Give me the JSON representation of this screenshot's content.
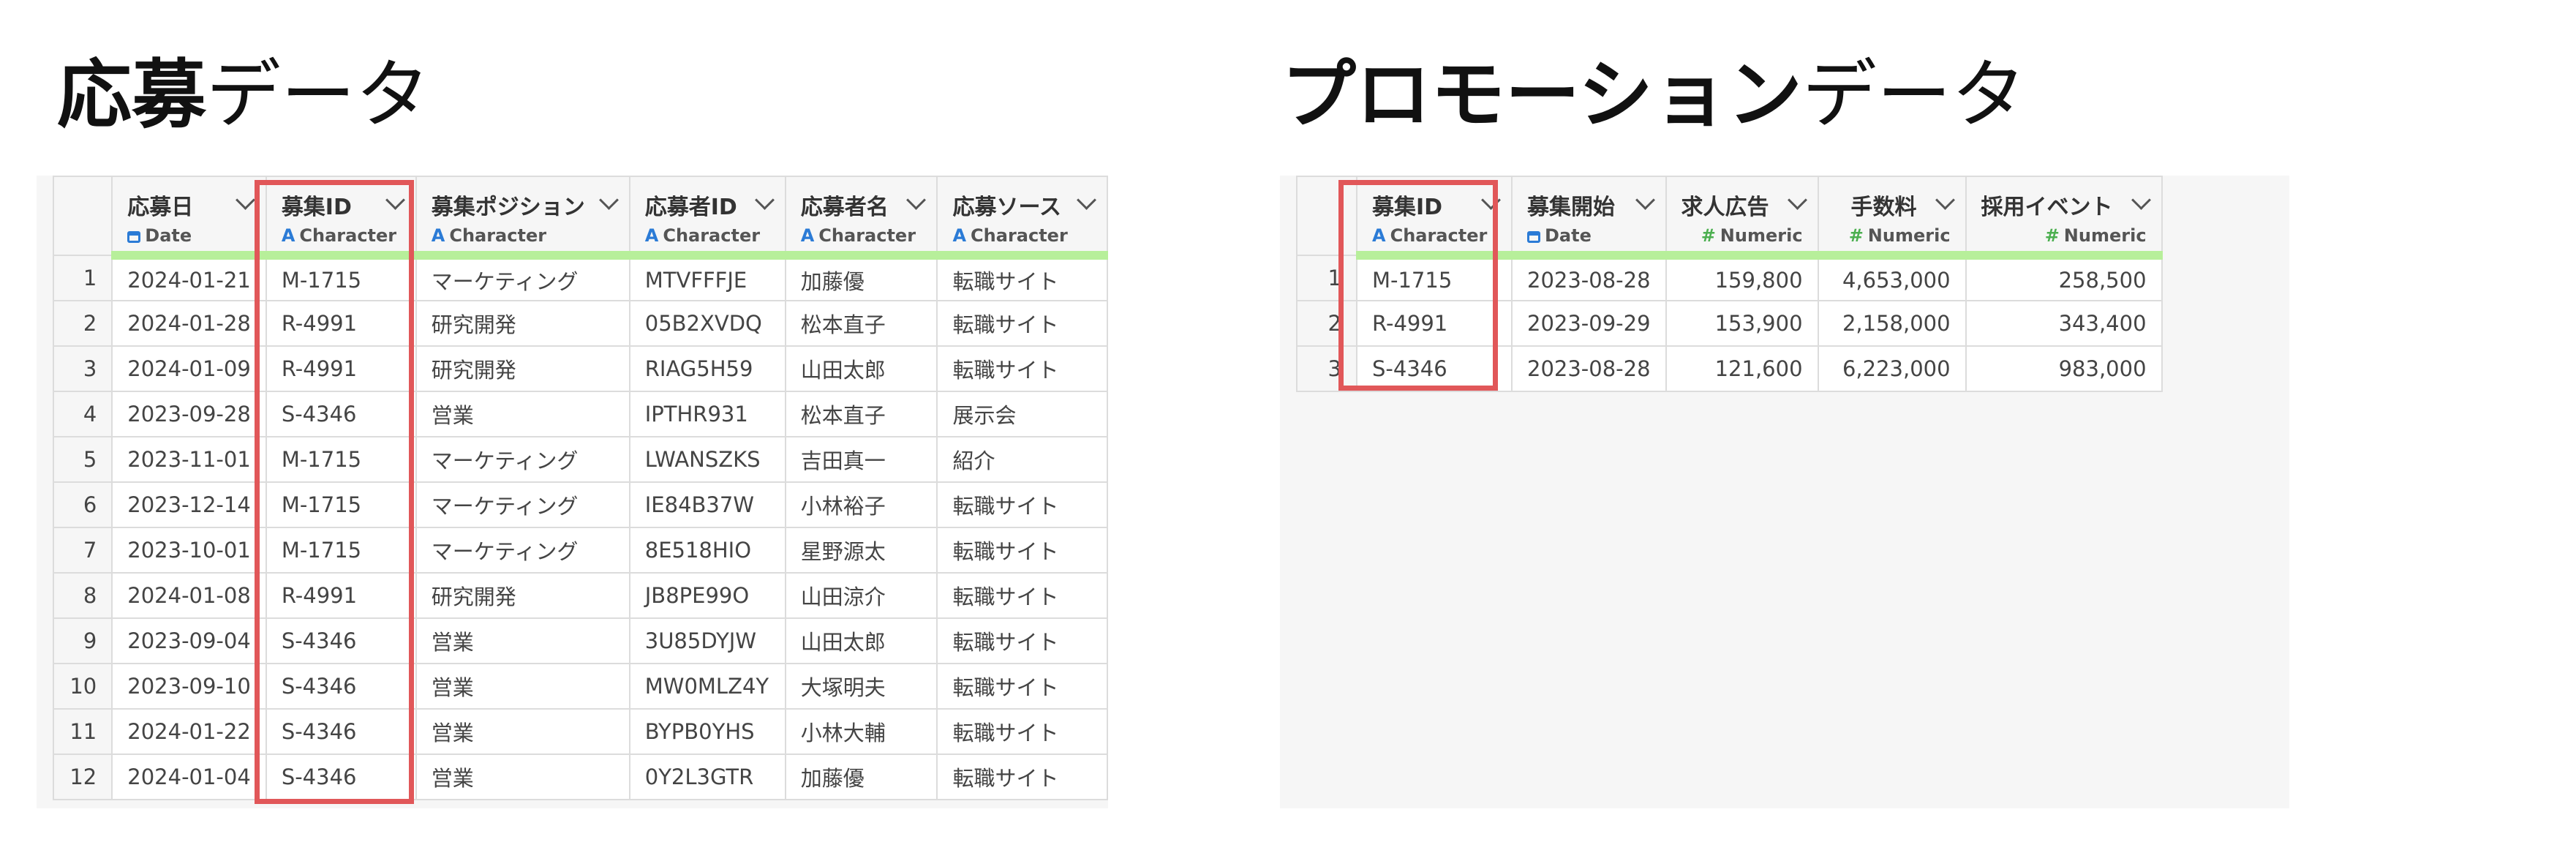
{
  "left_panel": {
    "title_bold": "応募",
    "title_light": "データ",
    "columns": [
      {
        "name": "応募日",
        "type": "Date",
        "type_icon": "calendar-icon"
      },
      {
        "name": "募集ID",
        "type": "Character",
        "type_icon": "character-type-icon"
      },
      {
        "name": "募集ポジション",
        "type": "Character",
        "type_icon": "character-type-icon"
      },
      {
        "name": "応募者ID",
        "type": "Character",
        "type_icon": "character-type-icon"
      },
      {
        "name": "応募者名",
        "type": "Character",
        "type_icon": "character-type-icon"
      },
      {
        "name": "応募ソース",
        "type": "Character",
        "type_icon": "character-type-icon"
      }
    ],
    "rows": [
      {
        "num": "1",
        "cells": [
          "2024-01-21",
          "M-1715",
          "マーケティング",
          "MTVFFFJE",
          "加藤優",
          "転職サイト"
        ]
      },
      {
        "num": "2",
        "cells": [
          "2024-01-28",
          "R-4991",
          "研究開発",
          "05B2XVDQ",
          "松本直子",
          "転職サイト"
        ]
      },
      {
        "num": "3",
        "cells": [
          "2024-01-09",
          "R-4991",
          "研究開発",
          "RIAG5H59",
          "山田太郎",
          "転職サイト"
        ]
      },
      {
        "num": "4",
        "cells": [
          "2023-09-28",
          "S-4346",
          "営業",
          "IPTHR931",
          "松本直子",
          "展示会"
        ]
      },
      {
        "num": "5",
        "cells": [
          "2023-11-01",
          "M-1715",
          "マーケティング",
          "LWANSZKS",
          "吉田真一",
          "紹介"
        ]
      },
      {
        "num": "6",
        "cells": [
          "2023-12-14",
          "M-1715",
          "マーケティング",
          "IE84B37W",
          "小林裕子",
          "転職サイト"
        ]
      },
      {
        "num": "7",
        "cells": [
          "2023-10-01",
          "M-1715",
          "マーケティング",
          "8E518HIO",
          "星野源太",
          "転職サイト"
        ]
      },
      {
        "num": "8",
        "cells": [
          "2024-01-08",
          "R-4991",
          "研究開発",
          "JB8PE99O",
          "山田涼介",
          "転職サイト"
        ]
      },
      {
        "num": "9",
        "cells": [
          "2023-09-04",
          "S-4346",
          "営業",
          "3U85DYJW",
          "山田太郎",
          "転職サイト"
        ]
      },
      {
        "num": "10",
        "cells": [
          "2023-09-10",
          "S-4346",
          "営業",
          "MW0MLZ4Y",
          "大塚明夫",
          "転職サイト"
        ]
      },
      {
        "num": "11",
        "cells": [
          "2024-01-22",
          "S-4346",
          "営業",
          "BYPB0YHS",
          "小林大輔",
          "転職サイト"
        ]
      },
      {
        "num": "12",
        "cells": [
          "2024-01-04",
          "S-4346",
          "営業",
          "0Y2L3GTR",
          "加藤優",
          "転職サイト"
        ]
      }
    ],
    "highlighted_column": "募集ID"
  },
  "right_panel": {
    "title_bold": "プロモーション",
    "title_light": "データ",
    "columns": [
      {
        "name": "募集ID",
        "type": "Character",
        "type_icon": "character-type-icon"
      },
      {
        "name": "募集開始",
        "type": "Date",
        "type_icon": "calendar-icon"
      },
      {
        "name": "求人広告",
        "type": "Numeric",
        "type_icon": "numeric-type-icon"
      },
      {
        "name": "手数料",
        "type": "Numeric",
        "type_icon": "numeric-type-icon"
      },
      {
        "name": "採用イベント",
        "type": "Numeric",
        "type_icon": "numeric-type-icon"
      }
    ],
    "rows": [
      {
        "num": "1",
        "cells": [
          "M-1715",
          "2023-08-28",
          "159,800",
          "4,653,000",
          "258,500"
        ]
      },
      {
        "num": "2",
        "cells": [
          "R-4991",
          "2023-09-29",
          "153,900",
          "2,158,000",
          "343,400"
        ]
      },
      {
        "num": "3",
        "cells": [
          "S-4346",
          "2023-08-28",
          "121,600",
          "6,223,000",
          "983,000"
        ]
      }
    ],
    "highlighted_column": "募集ID"
  },
  "colors": {
    "highlight_border": "#e15759",
    "type_bar": "#b7ef9a",
    "character_icon": "#2b7bd6",
    "numeric_icon": "#4caf50"
  }
}
